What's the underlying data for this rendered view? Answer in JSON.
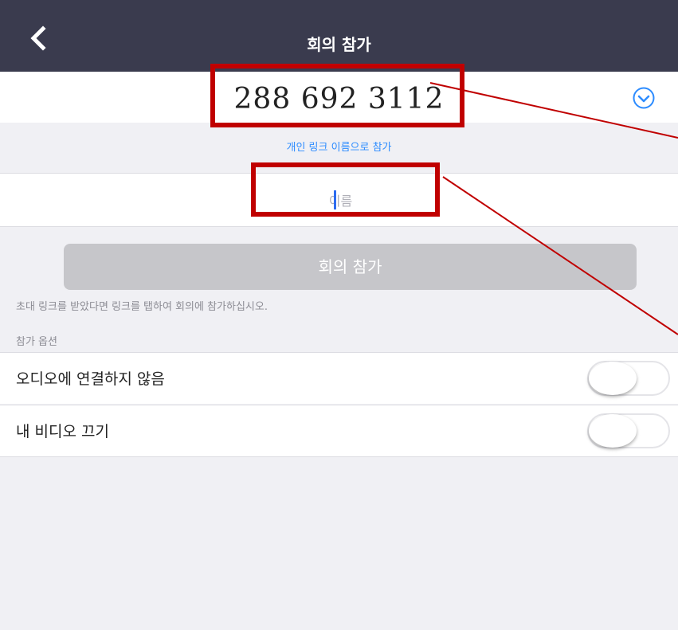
{
  "header": {
    "title": "회의 참가",
    "back_icon": "chevron-left-icon"
  },
  "meeting": {
    "id": "288  692 3112",
    "dropdown_icon": "chevron-down-circle-icon"
  },
  "personal_link_label": "개인 링크 이름으로 참가",
  "name_input": {
    "placeholder": "이름",
    "value": ""
  },
  "join_button_label": "회의 참가",
  "hint_text": "초대 링크를 받았다면 링크를 탭하여 회의에 참가하십시오.",
  "options": {
    "section_label": "참가 옵션",
    "items": [
      {
        "label": "오디오에 연결하지 않음",
        "on": false
      },
      {
        "label": "내 비디오 끄기",
        "on": false
      }
    ]
  },
  "colors": {
    "header_bg": "#3a3b4e",
    "accent_blue": "#2d8cff",
    "annotation_red": "#c00000",
    "join_button_disabled": "#c6c6ca"
  }
}
